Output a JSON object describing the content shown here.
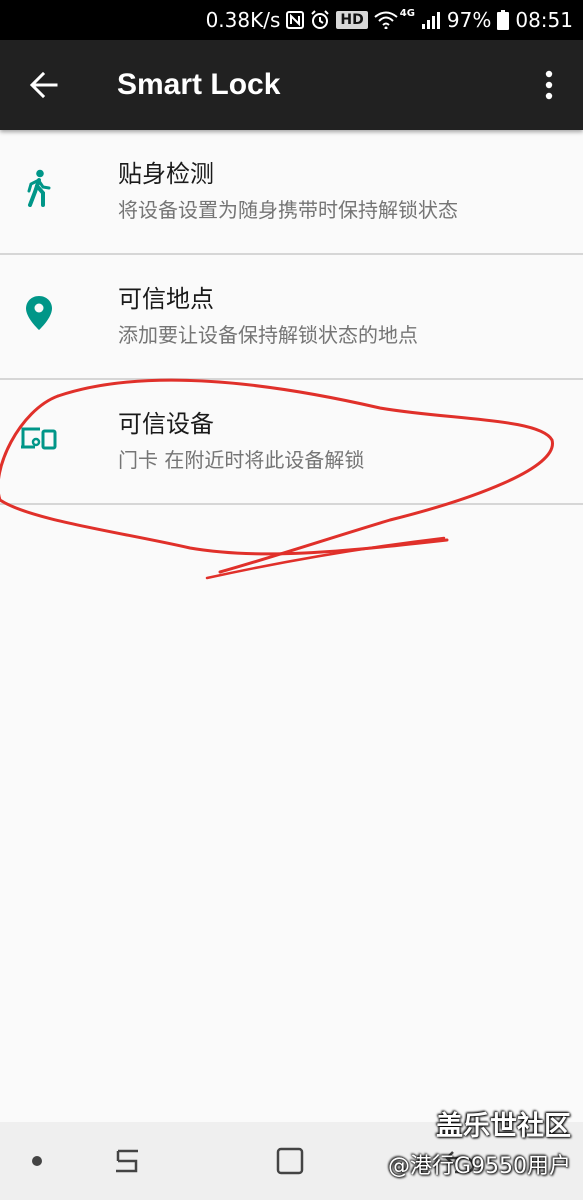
{
  "status_bar": {
    "net_speed": "0.38K/s",
    "nfc_icon": "nfc-icon",
    "alarm_icon": "alarm-icon",
    "hd_badge": "HD",
    "wifi_icon": "wifi-icon",
    "network_type": "4G",
    "signal_icon": "signal-icon",
    "battery_level": "97%",
    "battery_icon": "battery-icon",
    "time": "08:51"
  },
  "app_bar": {
    "title": "Smart Lock",
    "back_icon": "arrow-back-icon",
    "more_icon": "more-vert-icon"
  },
  "options": [
    {
      "title": "贴身检测",
      "subtitle": "将设备设置为随身携带时保持解锁状态",
      "icon": "walking-person-icon"
    },
    {
      "title": "可信地点",
      "subtitle": "添加要让设备保持解锁状态的地点",
      "icon": "location-pin-icon"
    },
    {
      "title": "可信设备",
      "subtitle": "门卡 在附近时将此设备解锁",
      "icon": "devices-icon"
    }
  ],
  "colors": {
    "accent": "#009688",
    "app_bar": "#212121",
    "background": "#fafafa",
    "annotation": "#e0302a"
  },
  "watermark": {
    "brand": "盖乐世社区",
    "user": "@港行G9550用户"
  }
}
